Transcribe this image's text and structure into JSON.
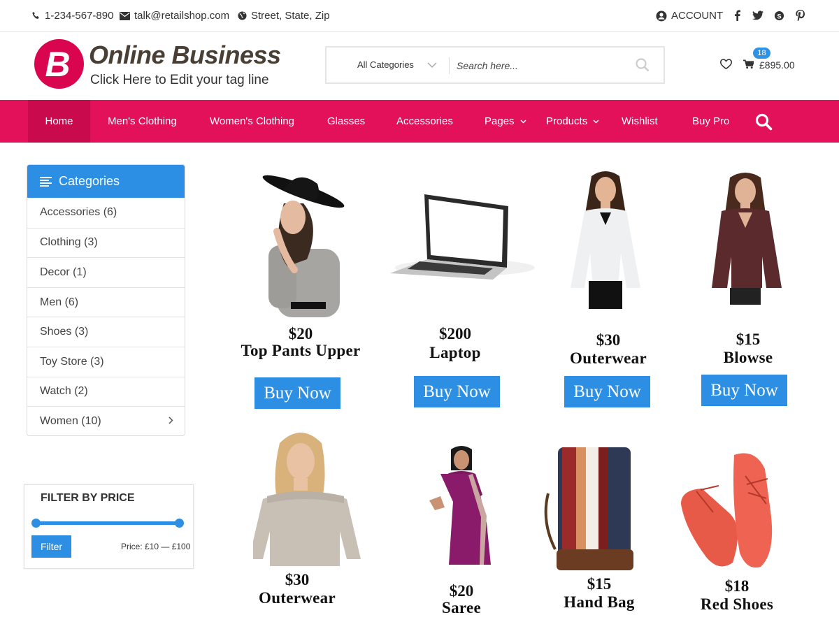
{
  "topbar": {
    "phone": "1-234-567-890",
    "email": "talk@retailshop.com",
    "address": "Street, State, Zip",
    "account": "ACCOUNT",
    "social": [
      "facebook-icon",
      "twitter-icon",
      "skype-icon",
      "pinterest-icon"
    ]
  },
  "header": {
    "logo_letter": "B",
    "site_title": "Online Business",
    "tagline": "Click Here to Edit your tag line",
    "search_category": "All Categories",
    "search_placeholder": "Search here...",
    "cart_count": "18",
    "cart_total": "£895.00"
  },
  "nav": {
    "items": [
      {
        "label": "Home"
      },
      {
        "label": "Men's Clothing"
      },
      {
        "label": "Women's Clothing"
      },
      {
        "label": "Glasses"
      },
      {
        "label": "Accessories"
      },
      {
        "label": "Pages"
      },
      {
        "label": "Products"
      },
      {
        "label": "Wishlist"
      },
      {
        "label": "Buy Pro"
      }
    ]
  },
  "sidebar": {
    "categories_title": "Categories",
    "categories": [
      {
        "label": "Accessories (6)"
      },
      {
        "label": "Clothing (3)"
      },
      {
        "label": "Decor (1)"
      },
      {
        "label": "Men (6)"
      },
      {
        "label": "Shoes (3)"
      },
      {
        "label": "Toy Store (3)"
      },
      {
        "label": "Watch (2)"
      },
      {
        "label": "Women (10)"
      }
    ],
    "filter": {
      "title": "FILTER BY PRICE",
      "button": "Filter",
      "price_label": "Price: £10 — £100",
      "range_fraction": [
        0,
        1
      ]
    }
  },
  "products": [
    {
      "price": "$20",
      "name": "Top Pants Upper",
      "button": "Buy Now"
    },
    {
      "price": "$200",
      "name": "Laptop",
      "button": "Buy Now"
    },
    {
      "price": "$30",
      "name": "Outerwear",
      "button": "Buy Now"
    },
    {
      "price": "$15",
      "name": "Blowse",
      "button": "Buy Now"
    },
    {
      "price": "$30",
      "name": "Outerwear"
    },
    {
      "price": "$20",
      "name": "Saree"
    },
    {
      "price": "$15",
      "name": "Hand Bag"
    },
    {
      "price": "$18",
      "name": "Red Shoes"
    }
  ],
  "colors": {
    "brand": "#e3115a",
    "accent": "#2c8fe4"
  }
}
